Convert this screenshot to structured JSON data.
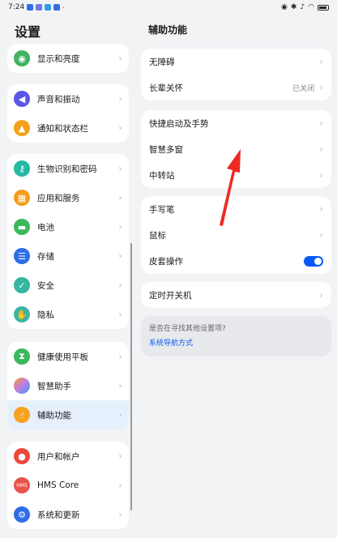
{
  "status_bar": {
    "time": "7:24"
  },
  "left": {
    "title": "设置",
    "groups": [
      [
        {
          "label": "显示和亮度",
          "icon": "eye-icon",
          "color": "#3fb360"
        }
      ],
      [
        {
          "label": "声音和振动",
          "icon": "speaker-icon",
          "color": "#5a57e8"
        },
        {
          "label": "通知和状态栏",
          "icon": "bell-icon",
          "color": "#f4a21b"
        }
      ],
      [
        {
          "label": "生物识别和密码",
          "icon": "key-icon",
          "color": "#25b8a3"
        },
        {
          "label": "应用和服务",
          "icon": "apps-icon",
          "color": "#f59c1a"
        },
        {
          "label": "电池",
          "icon": "battery-icon",
          "color": "#3cb85a"
        },
        {
          "label": "存储",
          "icon": "storage-icon",
          "color": "#2f6de8"
        },
        {
          "label": "安全",
          "icon": "shield-icon",
          "color": "#34b6a1"
        },
        {
          "label": "隐私",
          "icon": "hand-icon",
          "color": "#39b6a4"
        }
      ],
      [
        {
          "label": "健康使用平板",
          "icon": "hourglass-icon",
          "color": "#3ab85c"
        },
        {
          "label": "智慧助手",
          "icon": "assistant-icon",
          "color": "#c07be8"
        },
        {
          "label": "辅助功能",
          "icon": "accessibility-hand-icon",
          "color": "#f7a11e"
        }
      ],
      [
        {
          "label": "用户和帐户",
          "icon": "user-icon",
          "color": "#e94a3d"
        },
        {
          "label": "HMS Core",
          "icon": "hms-icon",
          "color": "#e8544b"
        },
        {
          "label": "系统和更新",
          "icon": "gear-icon",
          "color": "#2f6de8"
        }
      ]
    ]
  },
  "right": {
    "title": "辅助功能",
    "groups": [
      [
        {
          "label": "无障碍"
        },
        {
          "label": "长辈关怀",
          "value": "已关闭"
        }
      ],
      [
        {
          "label": "快捷启动及手势"
        },
        {
          "label": "智慧多窗"
        },
        {
          "label": "中转站"
        }
      ],
      [
        {
          "label": "手写笔"
        },
        {
          "label": "鼠标"
        },
        {
          "label": "皮套操作"
        }
      ],
      [
        {
          "label": "定时开关机"
        }
      ]
    ],
    "hint": {
      "question": "是否在寻找其他设置项?",
      "link": "系统导航方式"
    }
  },
  "hms_badge": "HMS"
}
